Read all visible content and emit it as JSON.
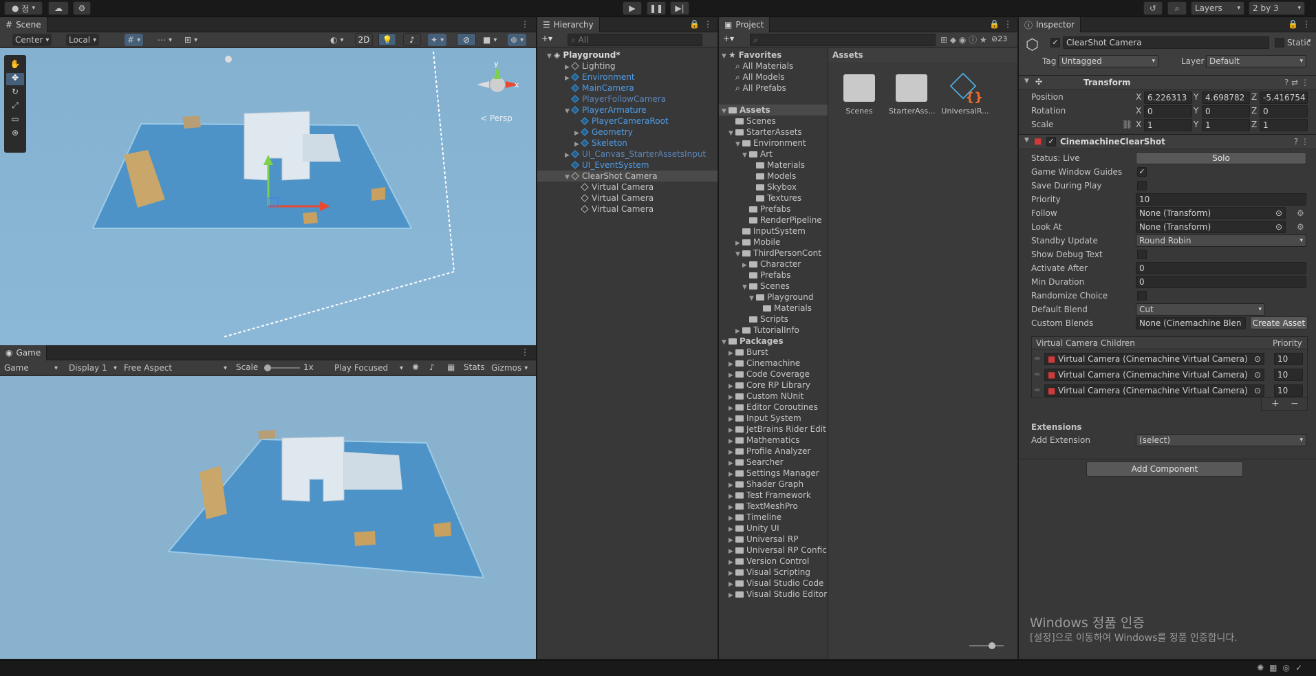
{
  "topbar": {
    "account_label": "정",
    "layers_label": "Layers",
    "layout_label": "2 by 3"
  },
  "scene": {
    "tab": "Scene",
    "pivot": "Center",
    "space": "Local",
    "mode_2d": "2D",
    "gizmo_x": "x",
    "gizmo_y": "y",
    "persp": "< Persp"
  },
  "game": {
    "tab": "Game",
    "view": "Game",
    "display": "Display 1",
    "aspect": "Free Aspect",
    "scale_label": "Scale",
    "scale_value": "1x",
    "play_mode": "Play Focused",
    "stats": "Stats",
    "gizmos": "Gizmos"
  },
  "hierarchy": {
    "tab": "Hierarchy",
    "search_placeholder": "All",
    "scene_name": "Playground*",
    "items": [
      {
        "label": "Lighting"
      },
      {
        "label": "Environment"
      },
      {
        "label": "MainCamera"
      },
      {
        "label": "PlayerFollowCamera"
      },
      {
        "label": "PlayerArmature"
      },
      {
        "label": "PlayerCameraRoot"
      },
      {
        "label": "Geometry"
      },
      {
        "label": "Skeleton"
      },
      {
        "label": "UI_Canvas_StarterAssetsInput"
      },
      {
        "label": "UI_EventSystem"
      },
      {
        "label": "ClearShot Camera"
      },
      {
        "label": "Virtual Camera"
      },
      {
        "label": "Virtual Camera"
      },
      {
        "label": "Virtual Camera"
      }
    ]
  },
  "project": {
    "tab": "Project",
    "hidden_count": "23",
    "favorites": [
      "Favorites",
      "All Materials",
      "All Models",
      "All Prefabs"
    ],
    "tree": [
      "Assets",
      "Scenes",
      "StarterAssets",
      "Environment",
      "Art",
      "Materials",
      "Models",
      "Skybox",
      "Textures",
      "Prefabs",
      "RenderPipeline",
      "InputSystem",
      "Mobile",
      "ThirdPersonCont",
      "Character",
      "Prefabs",
      "Scenes",
      "Playground",
      "Materials",
      "Scripts",
      "TutorialInfo"
    ],
    "packages": [
      "Packages",
      "Burst",
      "Cinemachine",
      "Code Coverage",
      "Core RP Library",
      "Custom NUnit",
      "Editor Coroutines",
      "Input System",
      "JetBrains Rider Edit",
      "Mathematics",
      "Profile Analyzer",
      "Searcher",
      "Settings Manager",
      "Shader Graph",
      "Test Framework",
      "TextMeshPro",
      "Timeline",
      "Unity UI",
      "Universal RP",
      "Universal RP Confic",
      "Version Control",
      "Visual Scripting",
      "Visual Studio Code",
      "Visual Studio Editor"
    ],
    "assets_header": "Assets",
    "asset_items": [
      {
        "label": "Scenes"
      },
      {
        "label": "StarterAss..."
      },
      {
        "label": "UniversalR..."
      }
    ]
  },
  "inspector": {
    "tab": "Inspector",
    "object_name": "ClearShot Camera",
    "static_label": "Static",
    "tag_label": "Tag",
    "tag_value": "Untagged",
    "layer_label": "Layer",
    "layer_value": "Default",
    "transform": {
      "title": "Transform",
      "position_label": "Position",
      "rotation_label": "Rotation",
      "scale_label": "Scale",
      "position": [
        "6.226313",
        "4.698782",
        "-5.416754"
      ],
      "rotation": [
        "0",
        "0",
        "0"
      ],
      "scale": [
        "1",
        "1",
        "1"
      ],
      "axes": [
        "X",
        "Y",
        "Z"
      ]
    },
    "clearshot": {
      "title": "CinemachineClearShot",
      "status": "Status: Live",
      "solo": "Solo",
      "props": {
        "game_window_guides": "Game Window Guides",
        "save_during_play": "Save During Play",
        "priority": "Priority",
        "priority_value": "10",
        "follow": "Follow",
        "follow_value": "None (Transform)",
        "look_at": "Look At",
        "look_at_value": "None (Transform)",
        "standby_update": "Standby Update",
        "standby_value": "Round Robin",
        "show_debug": "Show Debug Text",
        "activate_after": "Activate After",
        "activate_after_value": "0",
        "min_duration": "Min Duration",
        "min_duration_value": "0",
        "randomize": "Randomize Choice",
        "default_blend": "Default Blend",
        "default_blend_value": "Cut",
        "custom_blends": "Custom Blends",
        "custom_blends_value": "None (Cinemachine Blen",
        "create_asset": "Create Asset"
      },
      "children_header": "Virtual Camera Children",
      "priority_header": "Priority",
      "children": [
        {
          "name": "Virtual Camera (Cinemachine Virtual Camera)",
          "priority": "10"
        },
        {
          "name": "Virtual Camera (Cinemachine Virtual Camera)",
          "priority": "10"
        },
        {
          "name": "Virtual Camera (Cinemachine Virtual Camera)",
          "priority": "10"
        }
      ],
      "extensions": "Extensions",
      "add_extension": "Add Extension",
      "add_extension_value": "(select)"
    },
    "add_component": "Add Component"
  },
  "watermark": {
    "line1": "Windows 정품 인증",
    "line2": "[설정]으로 이동하여 Windows를 정품 인증합니다."
  },
  "colors": {
    "accent_blue": "#4f9de8",
    "scene_sky": "#8fb6d4",
    "floor": "#4d93c7"
  }
}
